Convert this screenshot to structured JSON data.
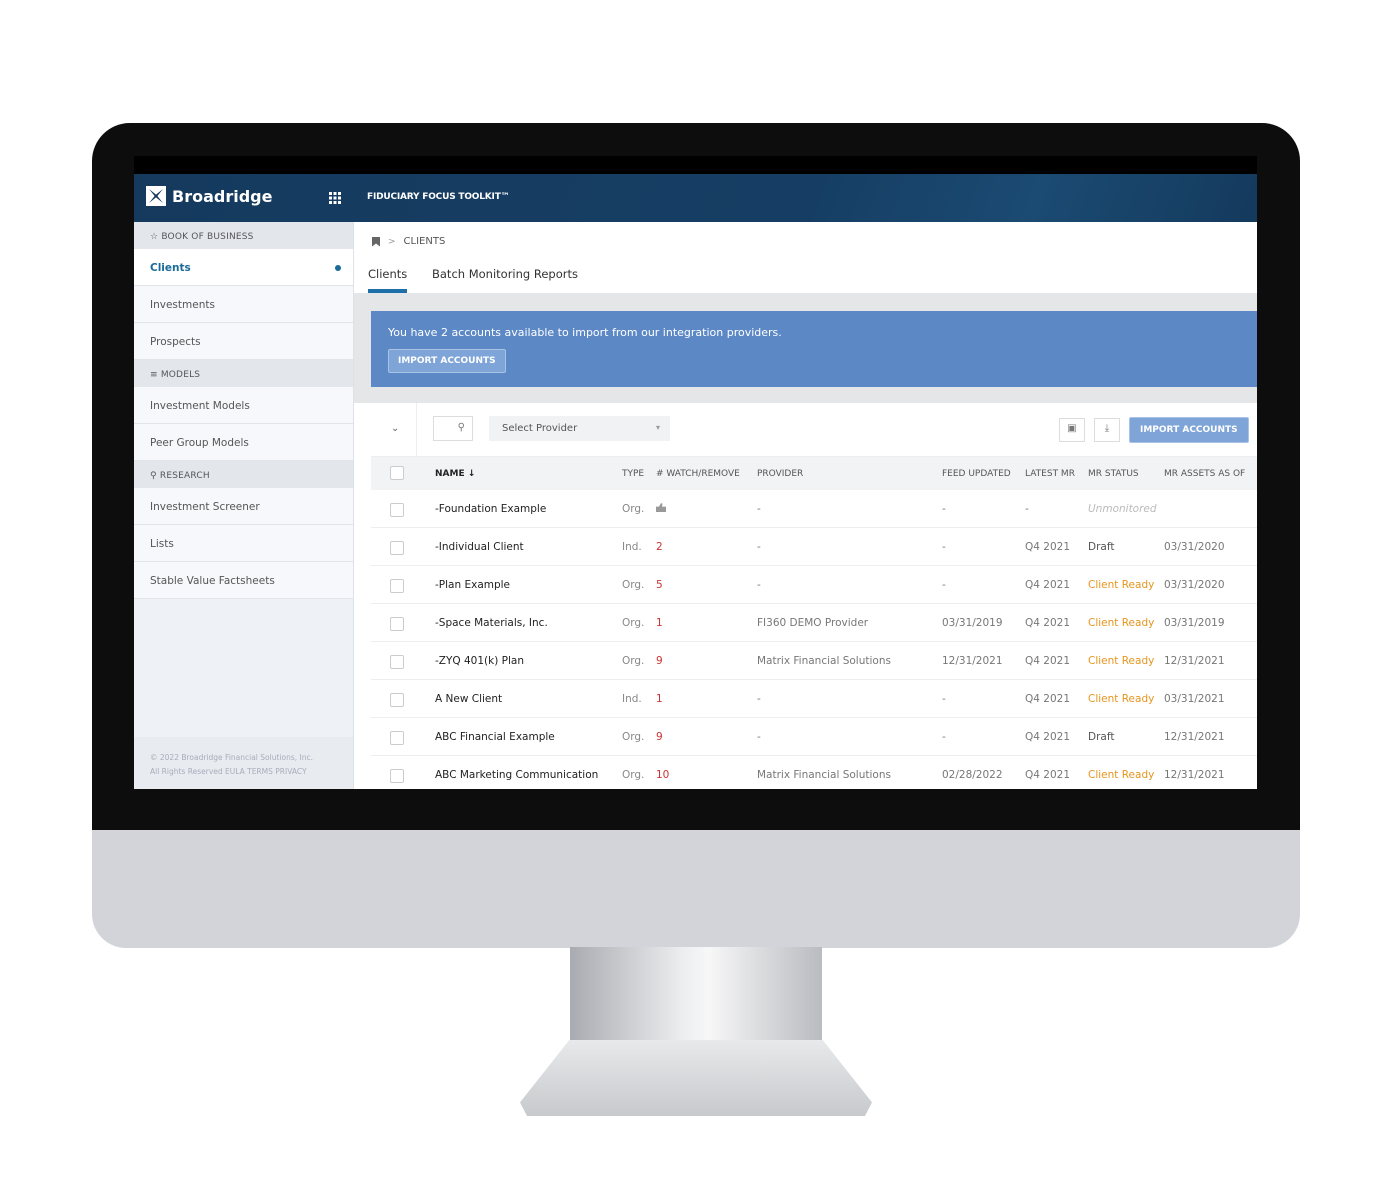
{
  "header": {
    "brand": "Broadridge",
    "app_title": "FIDUCIARY FOCUS TOOLKIT™"
  },
  "sidebar": {
    "sections": [
      {
        "label": "BOOK OF BUSINESS",
        "icon": "star-icon",
        "items": [
          {
            "label": "Clients",
            "active": true
          },
          {
            "label": "Investments"
          },
          {
            "label": "Prospects"
          }
        ]
      },
      {
        "label": "MODELS",
        "icon": "models-icon",
        "items": [
          {
            "label": "Investment Models"
          },
          {
            "label": "Peer Group Models"
          }
        ]
      },
      {
        "label": "RESEARCH",
        "icon": "search-icon",
        "items": [
          {
            "label": "Investment Screener"
          },
          {
            "label": "Lists"
          },
          {
            "label": "Stable Value Factsheets"
          }
        ]
      }
    ],
    "footer": [
      "© 2022 Broadridge Financial Solutions, Inc.",
      "All Rights Reserved EULA  TERMS  PRIVACY"
    ]
  },
  "breadcrumb": {
    "current": "CLIENTS"
  },
  "tabs": [
    {
      "label": "Clients",
      "active": true
    },
    {
      "label": "Batch Monitoring Reports"
    }
  ],
  "banner": {
    "message": "You have 2 accounts available to import from our integration providers.",
    "button": "IMPORT ACCOUNTS"
  },
  "toolbar": {
    "provider_placeholder": "Select Provider",
    "import_button": "IMPORT ACCOUNTS"
  },
  "table": {
    "columns": [
      "NAME ↓",
      "TYPE",
      "# WATCH/REMOVE",
      "PROVIDER",
      "FEED UPDATED",
      "LATEST MR",
      "MR STATUS",
      "MR ASSETS AS OF"
    ],
    "rows": [
      {
        "name": "-Foundation Example",
        "type": "Org.",
        "watch": "",
        "provider": "-",
        "feed": "-",
        "latest": "-",
        "status": "Unmonitored",
        "assets": ""
      },
      {
        "name": "-Individual Client",
        "type": "Ind.",
        "watch": "2",
        "provider": "-",
        "feed": "-",
        "latest": "Q4 2021",
        "status": "Draft",
        "assets": "03/31/2020"
      },
      {
        "name": "-Plan Example",
        "type": "Org.",
        "watch": "5",
        "provider": "-",
        "feed": "-",
        "latest": "Q4 2021",
        "status": "Client Ready",
        "assets": "03/31/2020"
      },
      {
        "name": "-Space Materials, Inc.",
        "type": "Org.",
        "watch": "1",
        "provider": "FI360 DEMO Provider",
        "feed": "03/31/2019",
        "latest": "Q4 2021",
        "status": "Client Ready",
        "assets": "03/31/2019"
      },
      {
        "name": "-ZYQ 401(k) Plan",
        "type": "Org.",
        "watch": "9",
        "provider": "Matrix Financial Solutions",
        "feed": "12/31/2021",
        "latest": "Q4 2021",
        "status": "Client Ready",
        "assets": "12/31/2021"
      },
      {
        "name": "A New Client",
        "type": "Ind.",
        "watch": "1",
        "provider": "-",
        "feed": "-",
        "latest": "Q4 2021",
        "status": "Client Ready",
        "assets": "03/31/2021"
      },
      {
        "name": "ABC Financial Example",
        "type": "Org.",
        "watch": "9",
        "provider": "-",
        "feed": "-",
        "latest": "Q4 2021",
        "status": "Draft",
        "assets": "12/31/2021"
      },
      {
        "name": "ABC Marketing Communication",
        "type": "Org.",
        "watch": "10",
        "provider": "Matrix Financial Solutions",
        "feed": "02/28/2022",
        "latest": "Q4 2021",
        "status": "Client Ready",
        "assets": "12/31/2021"
      }
    ]
  },
  "colors": {
    "header": "#153a5e",
    "accent": "#1f6fa8",
    "banner": "#5c88c6",
    "client_ready": "#e6951e",
    "watch_count": "#cc3333"
  }
}
